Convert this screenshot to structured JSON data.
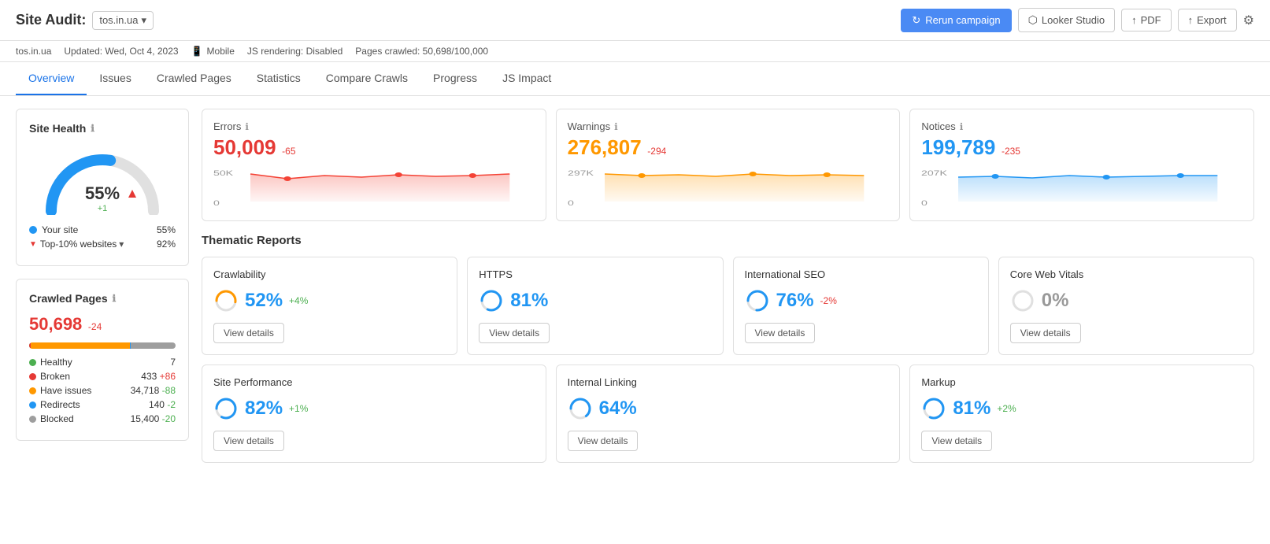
{
  "header": {
    "title": "Site Audit:",
    "campaign_name": "tos.in.ua",
    "dropdown_label": "tos.in.ua",
    "rerun_label": "Rerun campaign",
    "looker_label": "Looker Studio",
    "pdf_label": "PDF",
    "export_label": "Export"
  },
  "sub_header": {
    "domain": "tos.in.ua",
    "updated": "Updated: Wed, Oct 4, 2023",
    "device": "Mobile",
    "js_rendering": "JS rendering: Disabled",
    "pages_crawled": "Pages crawled: 50,698/100,000"
  },
  "nav": {
    "tabs": [
      "Overview",
      "Issues",
      "Crawled Pages",
      "Statistics",
      "Compare Crawls",
      "Progress",
      "JS Impact"
    ],
    "active": "Overview"
  },
  "site_health": {
    "title": "Site Health",
    "percent": "55%",
    "delta": "+1",
    "your_site_label": "Your site",
    "your_site_value": "55%",
    "top10_label": "Top-10% websites",
    "top10_value": "92%"
  },
  "crawled_pages": {
    "title": "Crawled Pages",
    "value": "50,698",
    "delta": "-24",
    "stats": [
      {
        "label": "Healthy",
        "value": "7",
        "delta": "",
        "color": "#4caf50"
      },
      {
        "label": "Broken",
        "value": "433",
        "delta": "+86",
        "delta_type": "red",
        "color": "#e53935"
      },
      {
        "label": "Have issues",
        "value": "34,718",
        "delta": "-88",
        "delta_type": "green",
        "color": "#ff9800"
      },
      {
        "label": "Redirects",
        "value": "140",
        "delta": "-2",
        "delta_type": "green",
        "color": "#2196f3"
      },
      {
        "label": "Blocked",
        "value": "15,400",
        "delta": "-20",
        "delta_type": "green",
        "color": "#9e9e9e"
      }
    ],
    "bar": {
      "green": 0.01,
      "red": 0.9,
      "orange": 68.6,
      "blue": 0.3,
      "gray": 30.4
    }
  },
  "errors": {
    "title": "Errors",
    "value": "50,009",
    "delta": "-65",
    "color": "#e53935"
  },
  "warnings": {
    "title": "Warnings",
    "value": "276,807",
    "delta": "-294",
    "color": "#ff9800"
  },
  "notices": {
    "title": "Notices",
    "value": "199,789",
    "delta": "-235",
    "color": "#2196f3"
  },
  "thematic_reports": {
    "title": "Thematic Reports",
    "row1": [
      {
        "title": "Crawlability",
        "score": "52%",
        "delta": "+4%",
        "delta_type": "pos",
        "circle_color": "#ff9800",
        "fill": 52
      },
      {
        "title": "HTTPS",
        "score": "81%",
        "delta": "",
        "delta_type": "neu",
        "circle_color": "#2196f3",
        "fill": 81
      },
      {
        "title": "International SEO",
        "score": "76%",
        "delta": "-2%",
        "delta_type": "neg",
        "circle_color": "#2196f3",
        "fill": 76
      },
      {
        "title": "Core Web Vitals",
        "score": "0%",
        "delta": "",
        "delta_type": "neu",
        "circle_color": "#ccc",
        "fill": 0
      }
    ],
    "row2": [
      {
        "title": "Site Performance",
        "score": "82%",
        "delta": "+1%",
        "delta_type": "pos",
        "circle_color": "#2196f3",
        "fill": 82
      },
      {
        "title": "Internal Linking",
        "score": "64%",
        "delta": "",
        "delta_type": "neu",
        "circle_color": "#2196f3",
        "fill": 64
      },
      {
        "title": "Markup",
        "score": "81%",
        "delta": "+2%",
        "delta_type": "pos",
        "circle_color": "#2196f3",
        "fill": 81
      }
    ],
    "view_details_label": "View details"
  },
  "icons": {
    "info": "ℹ",
    "mobile": "📱",
    "chevron_down": "▾",
    "refresh": "↻",
    "upload": "↑",
    "gear": "⚙"
  }
}
